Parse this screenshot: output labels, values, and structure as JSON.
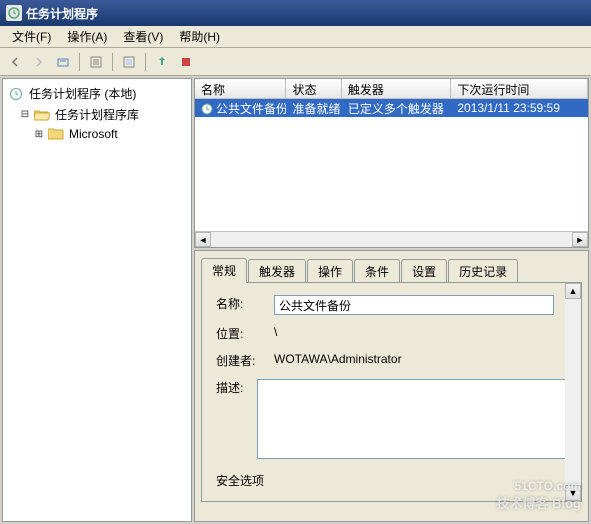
{
  "window": {
    "title": "任务计划程序"
  },
  "menu": {
    "file": "文件(F)",
    "action": "操作(A)",
    "view": "查看(V)",
    "help": "帮助(H)"
  },
  "tree": {
    "root": "任务计划程序 (本地)",
    "lib": "任务计划程序库",
    "microsoft": "Microsoft"
  },
  "list": {
    "headers": {
      "name": "名称",
      "status": "状态",
      "trigger": "触发器",
      "next": "下次运行时间"
    },
    "rows": [
      {
        "name": "公共文件备份",
        "status": "准备就绪",
        "trigger": "已定义多个触发器",
        "next": "2013/1/11 23:59:59"
      }
    ]
  },
  "tabs": {
    "general": "常规",
    "triggers": "触发器",
    "actions": "操作",
    "conditions": "条件",
    "settings": "设置",
    "history": "历史记录"
  },
  "form": {
    "name_label": "名称:",
    "name_value": "公共文件备份",
    "location_label": "位置:",
    "location_value": "\\",
    "creator_label": "创建者:",
    "creator_value": "WOTAWA\\Administrator",
    "desc_label": "描述:",
    "desc_value": "",
    "security_label": "安全选项"
  },
  "watermark": {
    "main": "51CTO.com",
    "sub": "技术博客   Blog"
  }
}
